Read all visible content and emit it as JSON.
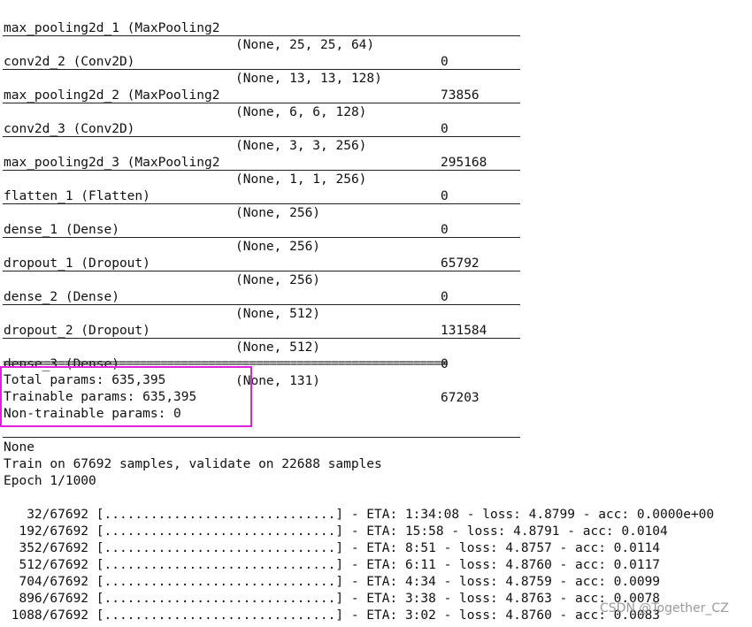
{
  "layers": [
    {
      "name": "max_pooling2d_1 (MaxPooling2",
      "shape": "(None, 25, 25, 64)",
      "params": "0"
    },
    {
      "name": "conv2d_2 (Conv2D)",
      "shape": "(None, 13, 13, 128)",
      "params": "73856"
    },
    {
      "name": "max_pooling2d_2 (MaxPooling2",
      "shape": "(None, 6, 6, 128)",
      "params": "0"
    },
    {
      "name": "conv2d_3 (Conv2D)",
      "shape": "(None, 3, 3, 256)",
      "params": "295168"
    },
    {
      "name": "max_pooling2d_3 (MaxPooling2",
      "shape": "(None, 1, 1, 256)",
      "params": "0"
    },
    {
      "name": "flatten_1 (Flatten)",
      "shape": "(None, 256)",
      "params": "0"
    },
    {
      "name": "dense_1 (Dense)",
      "shape": "(None, 256)",
      "params": "65792"
    },
    {
      "name": "dropout_1 (Dropout)",
      "shape": "(None, 256)",
      "params": "0"
    },
    {
      "name": "dense_2 (Dense)",
      "shape": "(None, 512)",
      "params": "131584"
    },
    {
      "name": "dropout_2 (Dropout)",
      "shape": "(None, 512)",
      "params": "0"
    },
    {
      "name": "dense_3 (Dense)",
      "shape": "(None, 131)",
      "params": "67203"
    }
  ],
  "double_rule": "=================================================================",
  "summary": {
    "total": "Total params: 635,395",
    "trainable": "Trainable params: 635,395",
    "non_trainable": "Non-trainable params: 0"
  },
  "log": {
    "none": "None",
    "train_info": "Train on 67692 samples, validate on 22688 samples",
    "epoch": "Epoch 1/1000"
  },
  "progress": [
    "   32/67692 [..............................] - ETA: 1:34:08 - loss: 4.8799 - acc: 0.0000e+00",
    "  192/67692 [..............................] - ETA: 15:58 - loss: 4.8791 - acc: 0.0104",
    "  352/67692 [..............................] - ETA: 8:51 - loss: 4.8757 - acc: 0.0114",
    "  512/67692 [..............................] - ETA: 6:11 - loss: 4.8760 - acc: 0.0117",
    "  704/67692 [..............................] - ETA: 4:34 - loss: 4.8759 - acc: 0.0099",
    "  896/67692 [..............................] - ETA: 3:38 - loss: 4.8763 - acc: 0.0078",
    " 1088/67692 [..............................] - ETA: 3:02 - loss: 4.8760 - acc: 0.0083"
  ],
  "watermark": "CSDN @Together_CZ",
  "colors": {
    "highlight_border": "#e020e0",
    "text": "#111111",
    "background": "#ffffff"
  }
}
